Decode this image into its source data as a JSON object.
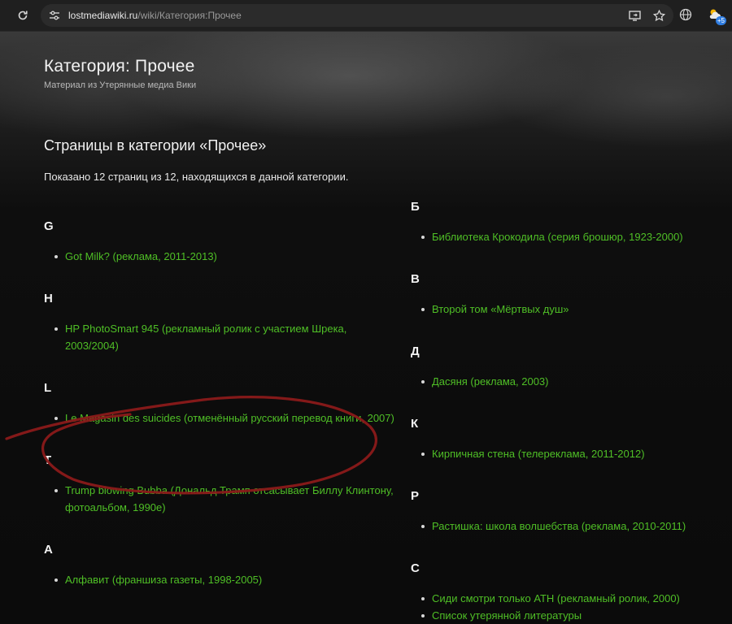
{
  "browser": {
    "url_host": "lostmediawiki.ru",
    "url_path": "/wiki/Категория:Прочее",
    "extension_badge": "+5"
  },
  "page": {
    "title": "Категория: Прочее",
    "subtitle": "Материал из Утерянные медиа Вики",
    "section_heading": "Страницы в категории «Прочее»",
    "count_text": "Показано 12 страниц из 12, находящихся в данной категории."
  },
  "left_groups": [
    {
      "letter": "G",
      "items": [
        "Got Milk? (реклама, 2011-2013)"
      ]
    },
    {
      "letter": "H",
      "items": [
        "HP PhotoSmart 945 (рекламный ролик с участием Шрека, 2003/2004)"
      ]
    },
    {
      "letter": "L",
      "items": [
        "Le Magasin des suicides (отменённый русский перевод книги, 2007)"
      ]
    },
    {
      "letter": "T",
      "items": [
        "Trump blowing Bubba (Дональд Трамп отсасывает Биллу Клинтону, фотоальбом, 1990е)"
      ]
    },
    {
      "letter": "А",
      "items": [
        "Алфавит (франшиза газеты, 1998-2005)"
      ]
    }
  ],
  "right_groups": [
    {
      "letter": "Б",
      "items": [
        "Библиотека Крокодила (серия брошюр, 1923-2000)"
      ]
    },
    {
      "letter": "В",
      "items": [
        "Второй том «Мёртвых душ»"
      ]
    },
    {
      "letter": "Д",
      "items": [
        "Дасяня (реклама, 2003)"
      ]
    },
    {
      "letter": "К",
      "items": [
        "Кирпичная стена (телереклама, 2011-2012)"
      ]
    },
    {
      "letter": "Р",
      "items": [
        "Растишка: школа волшебства (реклама, 2010-2011)"
      ]
    },
    {
      "letter": "С",
      "items": [
        "Сиди смотри только АТН (рекламный ролик, 2000)",
        "Список утерянной литературы"
      ]
    }
  ],
  "colors": {
    "link": "#4fbf26",
    "annotation": "#8b1a1a"
  }
}
